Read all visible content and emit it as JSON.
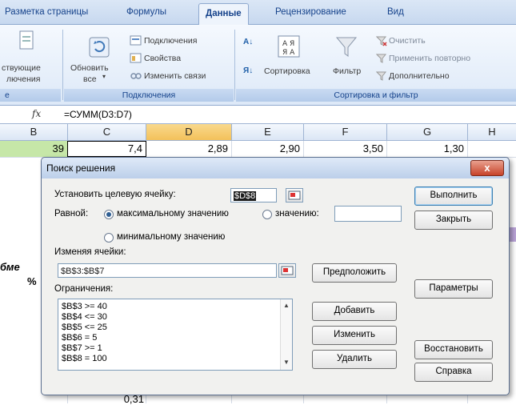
{
  "ribbon_tabs": [
    "Разметка страницы",
    "Формулы",
    "Данные",
    "Рецензирование",
    "Вид"
  ],
  "ribbon": {
    "existing_label_1": "ствующие",
    "existing_label_2": "лючения",
    "refresh_label_1": "Обновить",
    "refresh_label_2": "все",
    "connections": "Подключения",
    "properties": "Свойства",
    "edit_links": "Изменить связи",
    "sort_label": "Сортировка",
    "filter_label": "Фильтр",
    "clear": "Очистить",
    "reapply": "Применить повторно",
    "advanced": "Дополнительно",
    "group_connections": "Подключения",
    "group_sort_filter": "Сортировка и фильтр",
    "group_left_stub": "е"
  },
  "formula_bar": {
    "fx": "fx",
    "formula": "=СУММ(D3:D7)"
  },
  "columns": [
    "B",
    "C",
    "D",
    "E",
    "F",
    "G",
    "H"
  ],
  "grid": {
    "row1": [
      "39",
      "7,4",
      "2,89",
      "2,90",
      "3,50",
      "1,30"
    ],
    "side_text_1": "бме",
    "side_text_2": "%",
    "bottom_value": "0,31"
  },
  "dialog": {
    "title": "Поиск решения",
    "close": "x",
    "target_cell_label": "Установить целевую ячейку:",
    "target_cell_value": "$D$8",
    "equal_label": "Равной:",
    "opt_max": "максимальному значению",
    "opt_value": "значению:",
    "opt_min": "минимальному значению",
    "changing_label": "Изменяя ячейки:",
    "changing_value": "$B$3:$B$7",
    "constraints_label": "Ограничения:",
    "constraints": [
      "$B$3 >= 40",
      "$B$4 <= 30",
      "$B$5 <= 25",
      "$B$6 = 5",
      "$B$7 >= 1",
      "$B$8 = 100"
    ],
    "btn_solve": "Выполнить",
    "btn_close": "Закрыть",
    "btn_guess": "Предположить",
    "btn_options": "Параметры",
    "btn_add": "Добавить",
    "btn_change": "Изменить",
    "btn_delete": "Удалить",
    "btn_restore": "Восстановить",
    "btn_help": "Справка"
  }
}
